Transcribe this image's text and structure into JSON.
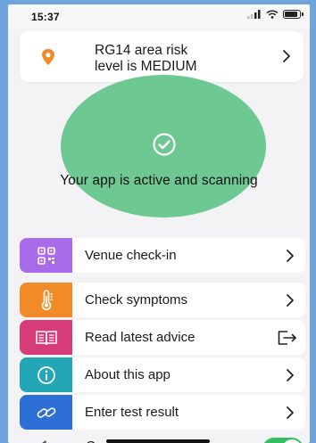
{
  "status_bar": {
    "time": "15:37"
  },
  "risk_card": {
    "line1": "RG14 area risk",
    "line2": "level is MEDIUM",
    "icon": "location-pin-icon",
    "accent_color": "#f08b28"
  },
  "status": {
    "message": "Your app is active and scanning",
    "circle_color": "#6dc892"
  },
  "menu": {
    "items": [
      {
        "label": "Venue check-in",
        "icon": "qr-code-icon",
        "color": "#a86bea",
        "trailing": "chevron"
      },
      {
        "label": "Check symptoms",
        "icon": "thermometer-icon",
        "color": "#f08b28",
        "trailing": "chevron"
      },
      {
        "label": "Read latest advice",
        "icon": "book-icon",
        "color": "#d63c78",
        "trailing": "external-link"
      },
      {
        "label": "About this app",
        "icon": "info-icon",
        "color": "#23a6b6",
        "trailing": "chevron"
      },
      {
        "label": "Enter test result",
        "icon": "link-icon",
        "color": "#2e6fd6",
        "trailing": "chevron"
      }
    ]
  },
  "bottom_row": {
    "partial_label": "C",
    "toggle_on": true,
    "toggle_color": "#33c062"
  }
}
